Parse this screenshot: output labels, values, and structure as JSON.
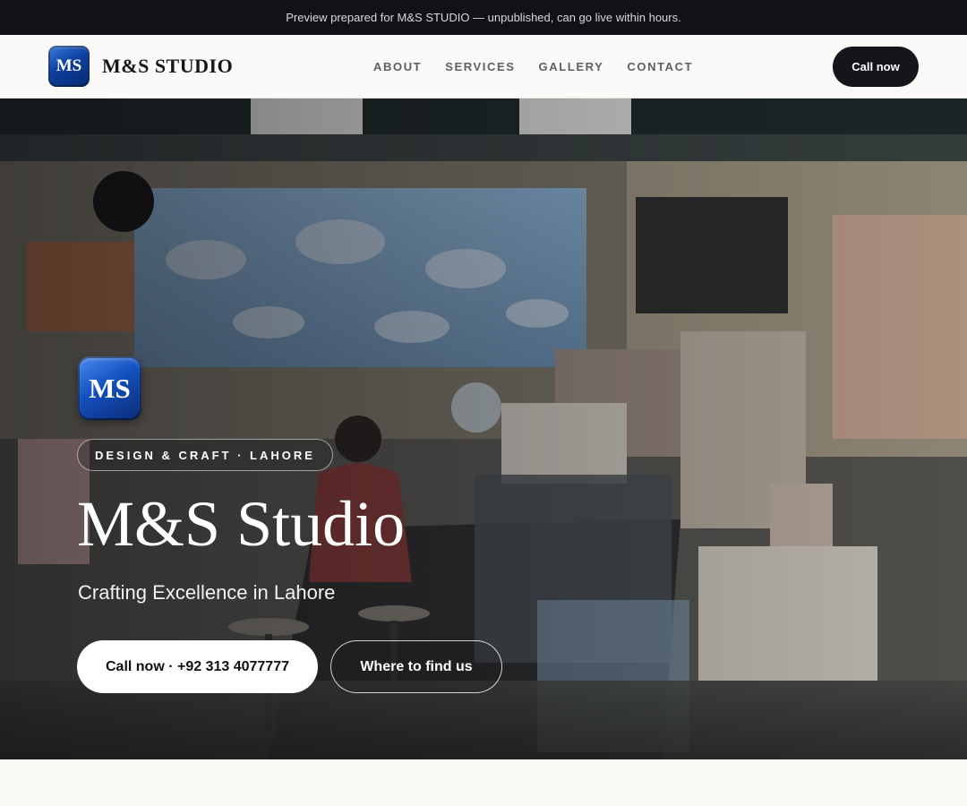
{
  "announcement": "Preview prepared for M&S STUDIO — unpublished, can go live within hours.",
  "brand": {
    "logo_text": "MS",
    "name": "M&S STUDIO"
  },
  "nav": {
    "links": [
      "ABOUT",
      "SERVICES",
      "GALLERY",
      "CONTACT"
    ],
    "call_label": "Call now"
  },
  "hero": {
    "logo_text": "MS",
    "eyebrow": "DESIGN & CRAFT · LAHORE",
    "title": "M&S Studio",
    "subtitle": "Crafting Excellence in Lahore",
    "primary_cta": "Call now · +92 313 4077777",
    "secondary_cta": "Where to find us",
    "background_image": "photo of a cluttered small shop interior with a woman seated at a counter"
  },
  "colors": {
    "topbar": "#101217",
    "nav_bg": "#fafaf8",
    "logo_blue": "#1450c0",
    "dark_button": "#14161b",
    "page_bg": "#faf9f6"
  }
}
